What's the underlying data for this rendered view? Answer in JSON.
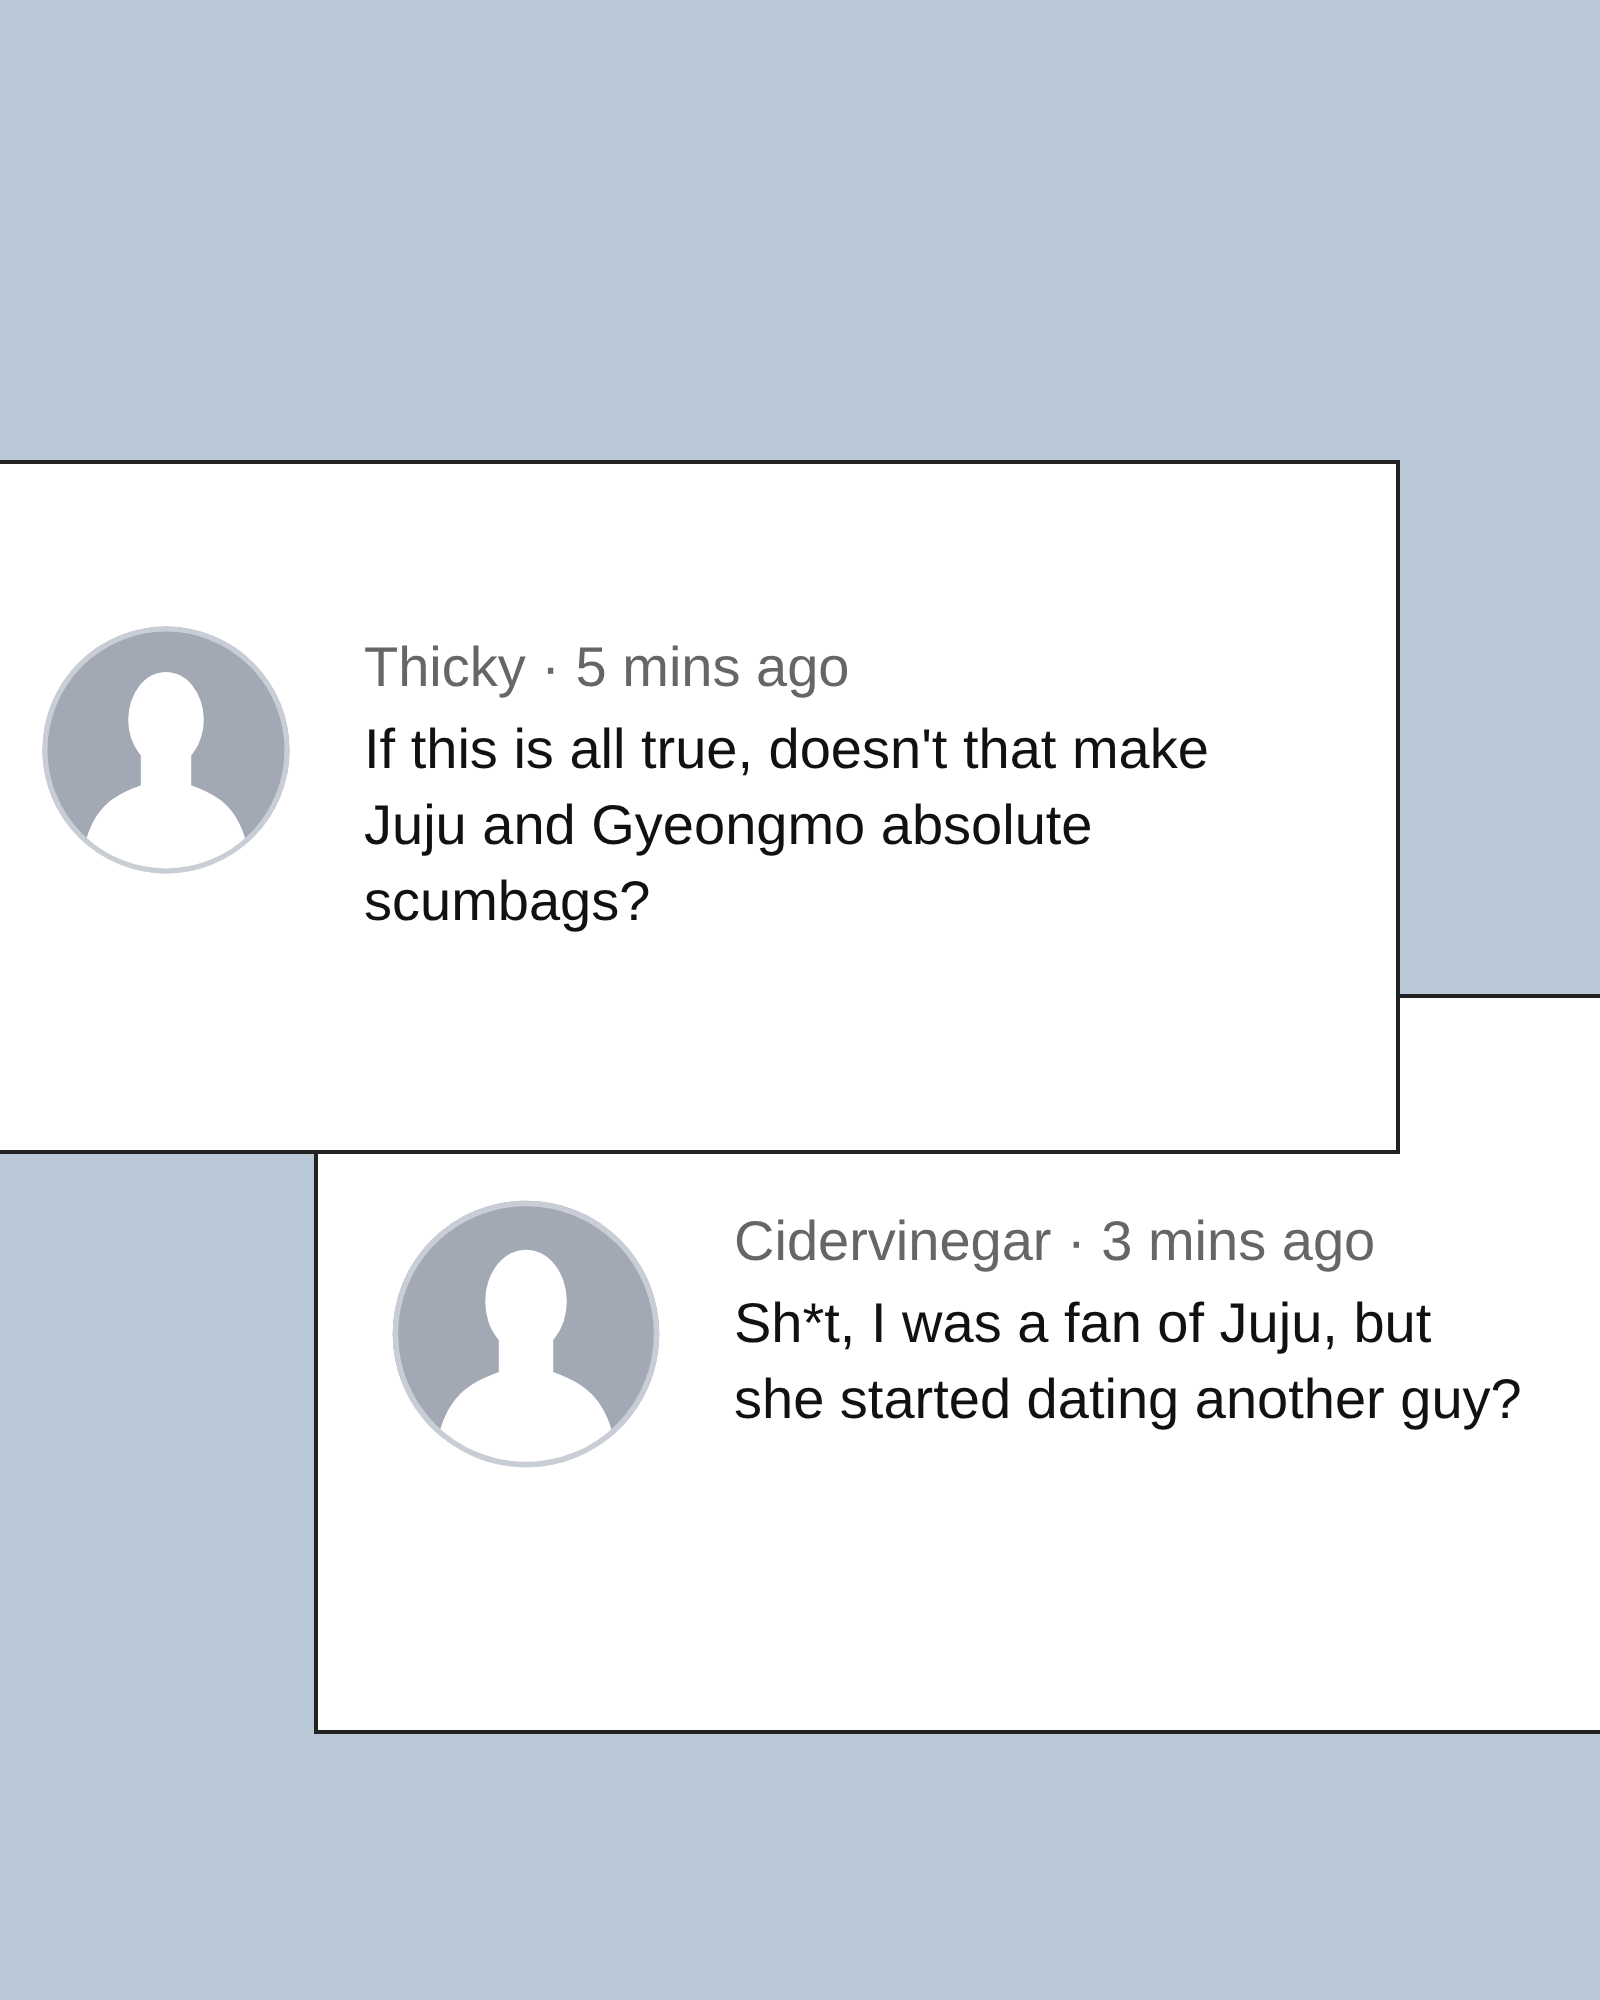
{
  "comments": [
    {
      "author_line": "Thicky · 5 mins ago",
      "text": "If this is all true, doesn't that make Juju and Gyeongmo absolute scumbags?"
    },
    {
      "author_line": "Cidervinegar · 3 mins ago",
      "text": "Sh*t, I was a fan of Juju, but she started dating another guy?"
    }
  ]
}
